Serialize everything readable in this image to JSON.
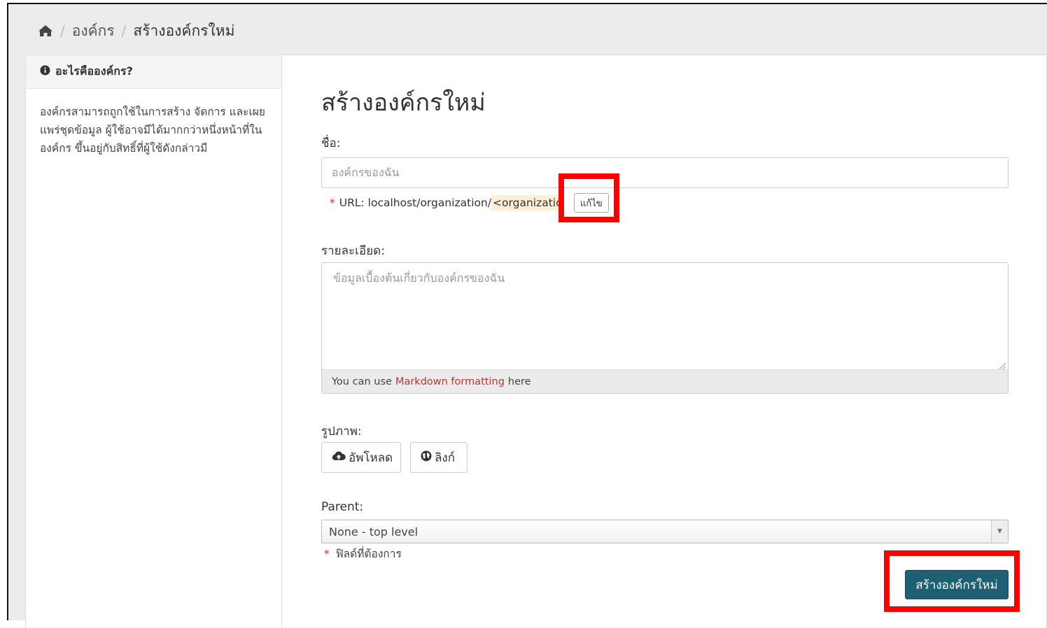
{
  "breadcrumb": {
    "home_icon": "home-icon",
    "items": [
      "องค์กร",
      "สร้างองค์กรใหม่"
    ]
  },
  "sidebar": {
    "info_icon": "info-circle-icon",
    "heading": "อะไรคือองค์กร?",
    "body": "องค์กรสามารถถูกใช้ในการสร้าง จัดการ และเผยแพร่ชุดข้อมูล ผู้ใช้อาจมีได้มากกว่าหนึ่งหน้าที่ในองค์กร ขึ้นอยู่กับสิทธิ์ที่ผู้ใช้ดังกล่าวมี"
  },
  "form": {
    "title": "สร้างองค์กรใหม่",
    "name_label": "ชื่อ:",
    "name_placeholder": "องค์กรของฉัน",
    "url_required_mark": "*",
    "url_prefix": "URL: localhost/organization/",
    "url_slug": "<organization>",
    "edit_button": "แก้ไข",
    "description_label": "รายละเอียด:",
    "description_placeholder": "ข้อมูลเบื้องต้นเกี่ยวกับองค์กรของฉัน",
    "markdown_prefix": "You can use",
    "markdown_link": "Markdown formatting",
    "markdown_suffix": "here",
    "image_label": "รูปภาพ:",
    "upload_button": "อัพโหลด",
    "link_button": "ลิงก์",
    "parent_label": "Parent:",
    "parent_selected": "None - top level",
    "required_mark": "*",
    "required_note": "ฟิลด์ที่ต้องการ",
    "submit_button": "สร้างองค์กรใหม่"
  },
  "colors": {
    "submit_bg": "#1e5f74",
    "highlight": "#ff0000",
    "link": "#b03a2e"
  }
}
